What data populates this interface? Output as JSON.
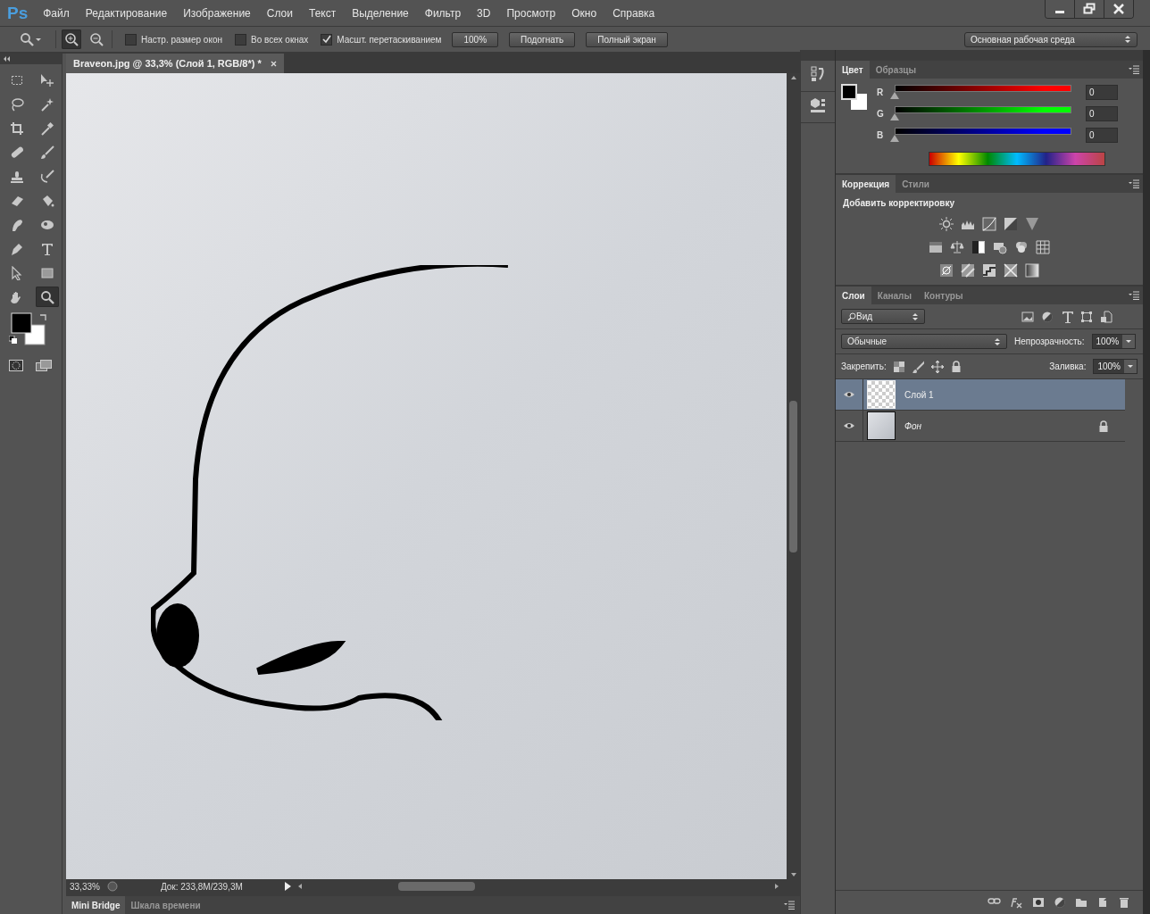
{
  "app": {
    "logo": "Ps"
  },
  "menu": [
    "Файл",
    "Редактирование",
    "Изображение",
    "Слои",
    "Текст",
    "Выделение",
    "Фильтр",
    "3D",
    "Просмотр",
    "Окно",
    "Справка"
  ],
  "options": {
    "zoom_modes": [
      {
        "kind": "in",
        "selected": true
      },
      {
        "kind": "out",
        "selected": false
      }
    ],
    "checkboxes": [
      {
        "label": "Настр. размер окон",
        "checked": false
      },
      {
        "label": "Во всех окнах",
        "checked": false
      },
      {
        "label": "Масшт. перетаскиванием",
        "checked": true
      }
    ],
    "buttons": [
      "100%",
      "Подогнать",
      "Полный экран"
    ],
    "workspace": "Основная рабочая среда"
  },
  "tools": [
    {
      "kind": "marquee",
      "selected": false
    },
    {
      "kind": "move",
      "selected": false
    },
    {
      "kind": "lasso",
      "selected": false
    },
    {
      "kind": "wand",
      "selected": false
    },
    {
      "kind": "crop",
      "selected": false
    },
    {
      "kind": "eyedropper",
      "selected": false
    },
    {
      "kind": "healing",
      "selected": false
    },
    {
      "kind": "brush",
      "selected": false
    },
    {
      "kind": "stamp",
      "selected": false
    },
    {
      "kind": "history",
      "selected": false
    },
    {
      "kind": "eraser",
      "selected": false
    },
    {
      "kind": "bucket",
      "selected": false
    },
    {
      "kind": "smudge",
      "selected": false
    },
    {
      "kind": "dodge",
      "selected": false
    },
    {
      "kind": "pen",
      "selected": false
    },
    {
      "kind": "type",
      "selected": false
    },
    {
      "kind": "path",
      "selected": false
    },
    {
      "kind": "shape",
      "selected": false
    },
    {
      "kind": "hand",
      "selected": false
    },
    {
      "kind": "zoom",
      "selected": true
    }
  ],
  "document": {
    "tab_title": "Braveon.jpg @ 33,3% (Слой 1, RGB/8*) *"
  },
  "status": {
    "zoom": "33,33%",
    "doc_size": "Док: 233,8M/239,3M"
  },
  "bottom_tabs": [
    {
      "label": "Mini Bridge",
      "selected": true
    },
    {
      "label": "Шкала времени",
      "selected": false
    }
  ],
  "color_panel": {
    "tabs": [
      {
        "label": "Цвет",
        "selected": true
      },
      {
        "label": "Образцы",
        "selected": false
      }
    ],
    "channels": [
      {
        "name": "R",
        "value": "0",
        "level": 0,
        "color": "#ff0000"
      },
      {
        "name": "G",
        "value": "0",
        "level": 0,
        "color": "#00ff00"
      },
      {
        "name": "B",
        "value": "0",
        "level": 0,
        "color": "#0000ff"
      }
    ]
  },
  "adjustments_panel": {
    "tabs": [
      {
        "label": "Коррекция",
        "selected": true
      },
      {
        "label": "Стили",
        "selected": false
      }
    ],
    "heading": "Добавить корректировку"
  },
  "layers_panel": {
    "tabs": [
      {
        "label": "Слои",
        "selected": true
      },
      {
        "label": "Каналы",
        "selected": false
      },
      {
        "label": "Контуры",
        "selected": false
      }
    ],
    "filter": "Вид",
    "blend_mode": "Обычные",
    "opacity_label": "Непрозрачность:",
    "opacity": "100%",
    "lock_label": "Закрепить:",
    "fill_label": "Заливка:",
    "fill": "100%",
    "layers": [
      {
        "name": "Слой 1",
        "kind": "layer",
        "selected": true,
        "visible": true,
        "locked": false
      },
      {
        "name": "Фон",
        "kind": "background",
        "selected": false,
        "visible": true,
        "locked": true
      }
    ]
  }
}
